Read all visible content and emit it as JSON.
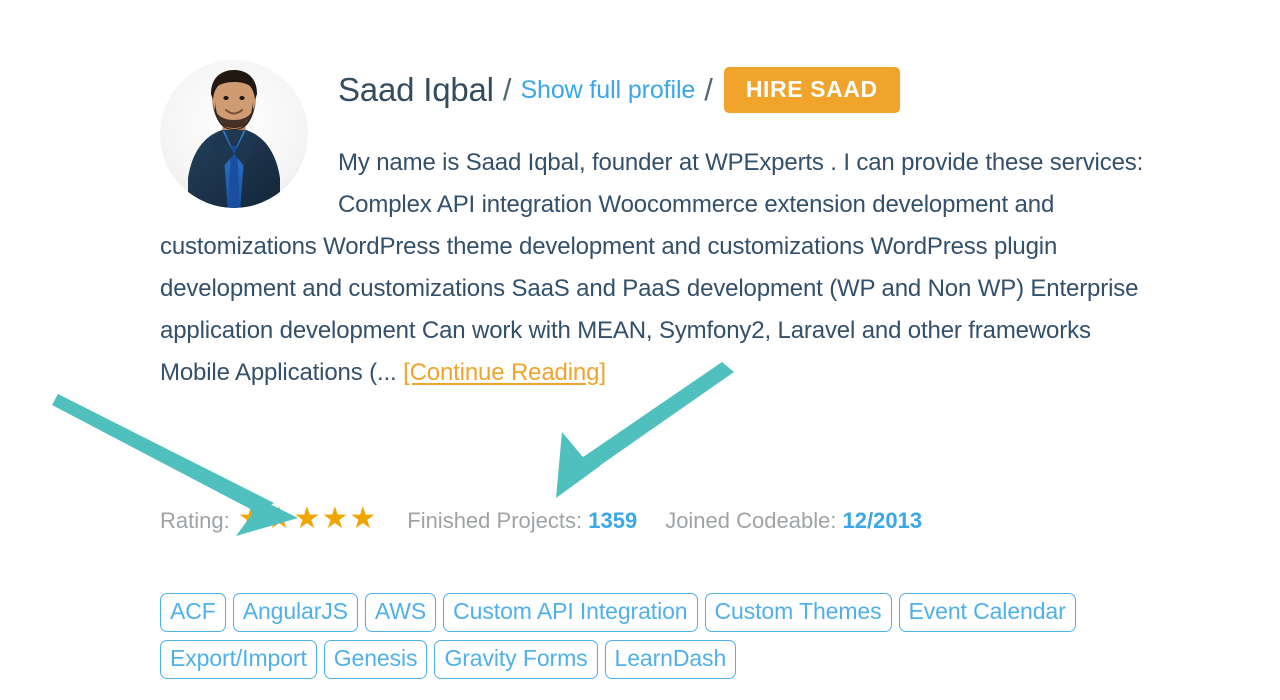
{
  "profile": {
    "name": "Saad Iqbal",
    "separator": "/",
    "show_profile_link": "Show full profile",
    "hire_button": "HIRE SAAD",
    "avatar_alt": "profile-photo",
    "bio_text": "My name is Saad Iqbal, founder at WPExperts . I can provide these services: Complex API integration Woocommerce extension development and customizations WordPress theme development and customizations WordPress plugin development and customizations SaaS and PaaS development (WP and Non WP) Enterprise application development Can work with MEAN, Symfony2, Laravel and other frameworks Mobile Applications (...",
    "continue_reading": "[Continue Reading]"
  },
  "meta": {
    "rating_label": "Rating:",
    "rating_stars": 5,
    "star_glyph": "★",
    "finished_projects_label": "Finished Projects:",
    "finished_projects_value": "1359",
    "joined_label": "Joined Codeable:",
    "joined_value": "12/2013"
  },
  "tags": [
    "ACF",
    "AngularJS",
    "AWS",
    "Custom API Integration",
    "Custom Themes",
    "Event Calendar",
    "Export/Import",
    "Genesis",
    "Gravity Forms",
    "LearnDash"
  ],
  "annotations": {
    "arrow_color": "#4fc0bd",
    "arrow_1_target": "rating-stars",
    "arrow_2_target": "finished-projects-value"
  },
  "colors": {
    "name_text": "#334c5e",
    "link_blue": "#3aa8e8",
    "accent_orange": "#f0a42c",
    "star_orange": "#f0a500",
    "tag_blue": "#4fb0ea",
    "muted_gray": "#9fa3a6",
    "bio_text": "#33506b",
    "background": "#ffffff"
  }
}
